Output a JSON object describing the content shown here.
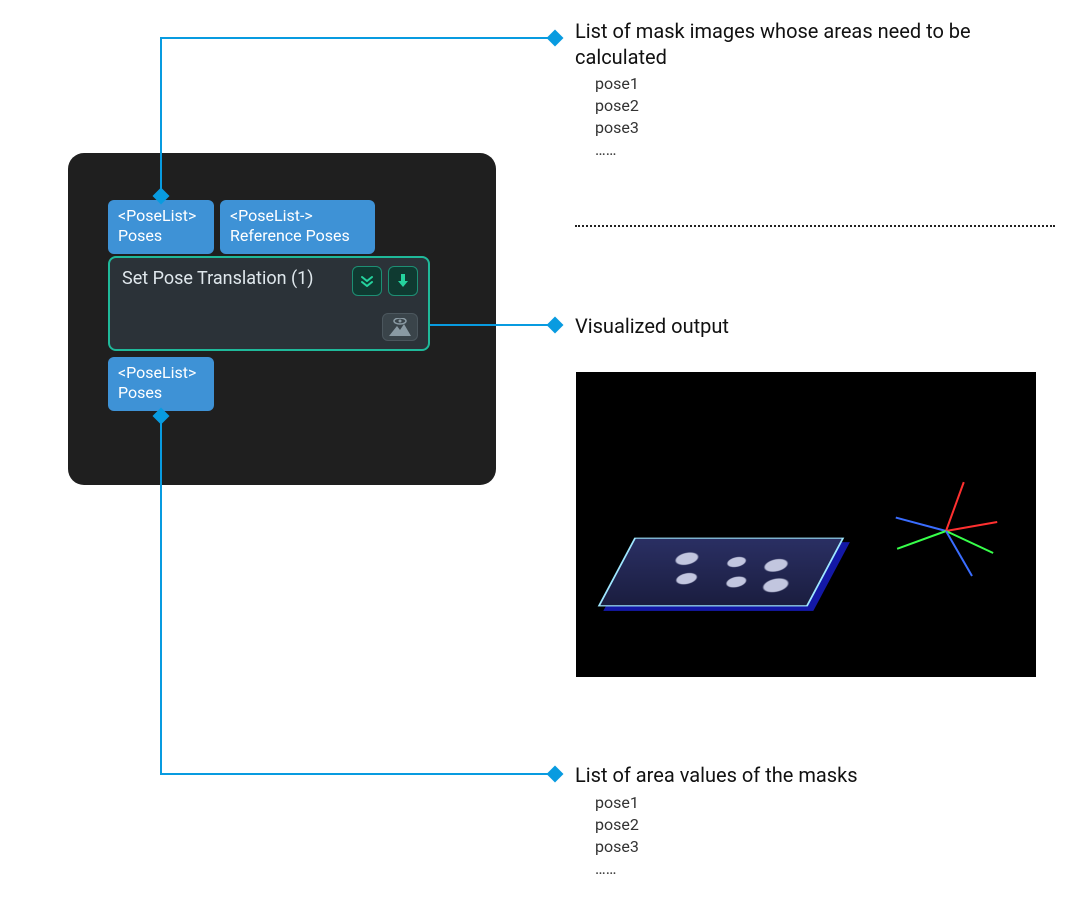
{
  "node": {
    "in_port_1_type": "<PoseList>",
    "in_port_1_name": "Poses",
    "in_port_2_type": "<PoseList->",
    "in_port_2_name": "Reference Poses",
    "title": "Set Pose Translation (1)",
    "out_port_type": "<PoseList>",
    "out_port_name": "Poses"
  },
  "callouts": {
    "top": {
      "title": "List of mask images whose areas need to be calculated",
      "items": [
        "pose1",
        "pose2",
        "pose3",
        "……"
      ]
    },
    "middle": {
      "title": "Visualized output"
    },
    "bottom": {
      "title": "List of area values of the masks",
      "items": [
        "pose1",
        "pose2",
        "pose3",
        "……"
      ]
    }
  }
}
